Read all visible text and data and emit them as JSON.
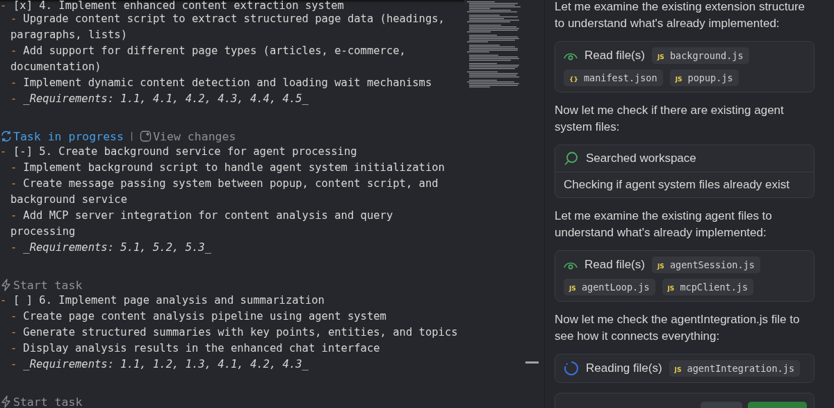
{
  "editor": {
    "lines": [
      {
        "kind": "task",
        "bullet": "-",
        "text": "[x] 4. Implement enhanced content extraction system"
      },
      {
        "kind": "sub",
        "bullet": "-",
        "text": "Upgrade content script to extract structured page data (headings, paragraphs, lists)"
      },
      {
        "kind": "sub",
        "bullet": "-",
        "text": "Add support for different page types (articles, e-commerce, documentation)"
      },
      {
        "kind": "sub",
        "bullet": "-",
        "text": "Implement dynamic content detection and loading wait mechanisms"
      },
      {
        "kind": "req",
        "bullet": "-",
        "text": "_Requirements: 1.1, 4.1, 4.2, 4.3, 4.4, 4.5_"
      },
      {
        "kind": "lens_progress",
        "label": "Task in progress",
        "separator": "|",
        "secondary": "View changes"
      },
      {
        "kind": "task",
        "bullet": "-",
        "text": "[-] 5. Create background service for agent processing"
      },
      {
        "kind": "sub",
        "bullet": "-",
        "text": "Implement background script to handle agent system initialization"
      },
      {
        "kind": "sub",
        "bullet": "-",
        "text": "Create message passing system between popup, content script, and background service"
      },
      {
        "kind": "sub",
        "bullet": "-",
        "text": "Add MCP server integration for content analysis and query processing"
      },
      {
        "kind": "req",
        "bullet": "-",
        "text": "_Requirements: 5.1, 5.2, 5.3_"
      },
      {
        "kind": "lens_start",
        "label": "Start task"
      },
      {
        "kind": "task",
        "bullet": "-",
        "text": "[ ] 6. Implement page analysis and summarization"
      },
      {
        "kind": "sub",
        "bullet": "-",
        "text": "Create page content analysis pipeline using agent system"
      },
      {
        "kind": "sub",
        "bullet": "-",
        "text": "Generate structured summaries with key points, entities, and topics"
      },
      {
        "kind": "sub",
        "bullet": "-",
        "text": "Display analysis results in the enhanced chat interface"
      },
      {
        "kind": "req",
        "bullet": "-",
        "text": "_Requirements: 1.1, 1.2, 1.3, 4.1, 4.2, 4.3_"
      },
      {
        "kind": "lens_start",
        "label": "Start task"
      }
    ]
  },
  "chat": {
    "items": [
      {
        "kind": "message",
        "text": "Let me examine the existing extension structure to understand what's already implemented:"
      },
      {
        "kind": "read",
        "label": "Read file(s)",
        "files": [
          {
            "badge": "JS",
            "name": "background.js"
          },
          {
            "badge": "{}",
            "name": "manifest.json"
          },
          {
            "badge": "JS",
            "name": "popup.js"
          }
        ]
      },
      {
        "kind": "message",
        "text": "Now let me check if there are existing agent system files:"
      },
      {
        "kind": "search",
        "label": "Searched workspace",
        "detail": "Checking if agent system files already exist"
      },
      {
        "kind": "message",
        "text": "Let me examine the existing agent files to understand what's already implemented:"
      },
      {
        "kind": "read",
        "label": "Read file(s)",
        "files": [
          {
            "badge": "JS",
            "name": "agentSession.js"
          },
          {
            "badge": "JS",
            "name": "agentLoop.js"
          },
          {
            "badge": "JS",
            "name": "mcpClient.js"
          }
        ]
      },
      {
        "kind": "message",
        "text": "Now let me check the agentIntegration.js file to see how it connects everything:"
      },
      {
        "kind": "reading",
        "label": "Reading file(s)",
        "files": [
          {
            "badge": "JS",
            "name": "agentIntegration.js"
          }
        ]
      },
      {
        "kind": "actions"
      }
    ]
  }
}
